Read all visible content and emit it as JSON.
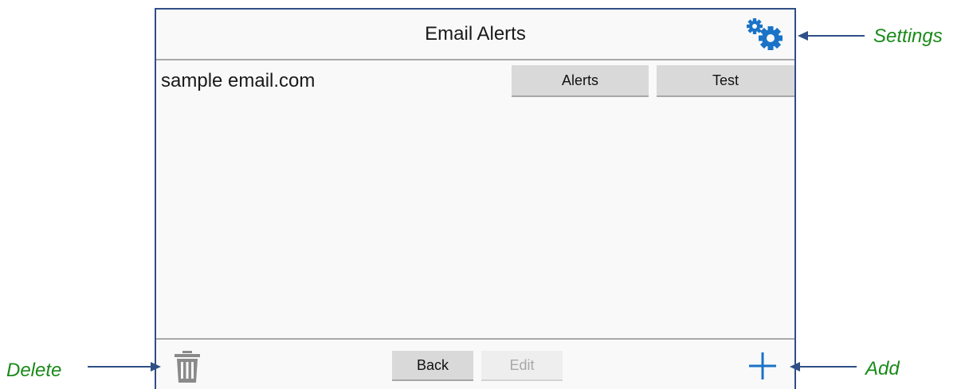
{
  "header": {
    "title": "Email Alerts"
  },
  "list": [
    {
      "email": "sample email.com",
      "alerts_label": "Alerts",
      "test_label": "Test"
    }
  ],
  "footer": {
    "back_label": "Back",
    "edit_label": "Edit"
  },
  "annotations": {
    "settings": "Settings",
    "delete": "Delete",
    "add": "Add"
  },
  "icons": {
    "settings": "gears-icon",
    "delete": "trash-icon",
    "add": "plus-icon"
  },
  "colors": {
    "accent": "#1a73c7",
    "annotation": "#1a8a1a",
    "arrow": "#2f4f86",
    "frame": "#2f4f86"
  }
}
